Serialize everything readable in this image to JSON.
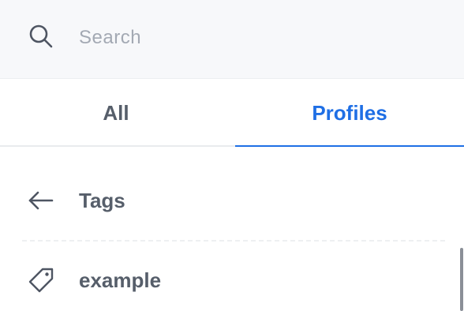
{
  "search": {
    "placeholder": "Search",
    "value": "",
    "icon": "search-icon"
  },
  "tabs": [
    {
      "label": "All",
      "active": false
    },
    {
      "label": "Profiles",
      "active": true
    }
  ],
  "list": {
    "back": {
      "label": "Tags",
      "icon": "arrow-left-icon"
    },
    "items": [
      {
        "label": "example",
        "icon": "tag-icon"
      }
    ]
  },
  "colors": {
    "accent": "#1f6fe5",
    "text": "#565e6a",
    "placeholder": "#a3a9b3",
    "search_bg": "#f7f8fa"
  }
}
